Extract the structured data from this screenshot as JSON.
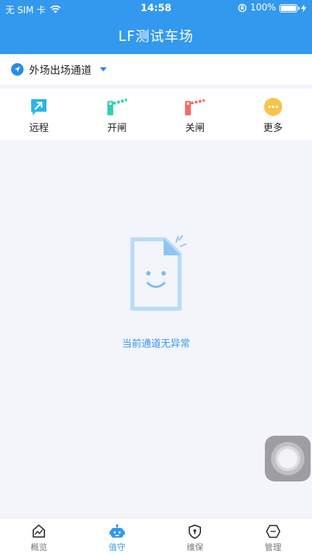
{
  "status_bar": {
    "carrier": "无 SIM 卡",
    "time": "14:58",
    "battery": "100%",
    "wifi_icon": "wifi-icon",
    "lock_icon": "orientation-lock-icon",
    "charging_icon": "charging-bolt-icon"
  },
  "header": {
    "title": "LF测试车场"
  },
  "channel": {
    "name": "外场出场通道",
    "icon": "location-arrow-icon"
  },
  "actions": [
    {
      "label": "远程",
      "icon": "remote-icon",
      "color": "#29b6e8"
    },
    {
      "label": "开闸",
      "icon": "gate-open-icon",
      "color": "#2ed0b0"
    },
    {
      "label": "关闸",
      "icon": "gate-close-icon",
      "color": "#f26b6b"
    },
    {
      "label": "更多",
      "icon": "more-icon",
      "color": "#f9c34a"
    }
  ],
  "empty_state": {
    "message": "当前通道无异常",
    "icon": "smiling-document-icon"
  },
  "tabs": [
    {
      "label": "概览",
      "icon": "overview-icon",
      "active": false
    },
    {
      "label": "值守",
      "icon": "robot-icon",
      "active": true
    },
    {
      "label": "维保",
      "icon": "shield-icon",
      "active": false
    },
    {
      "label": "管理",
      "icon": "manage-icon",
      "active": false
    }
  ],
  "colors": {
    "primary": "#3399ee",
    "background": "#f4f4fb"
  }
}
